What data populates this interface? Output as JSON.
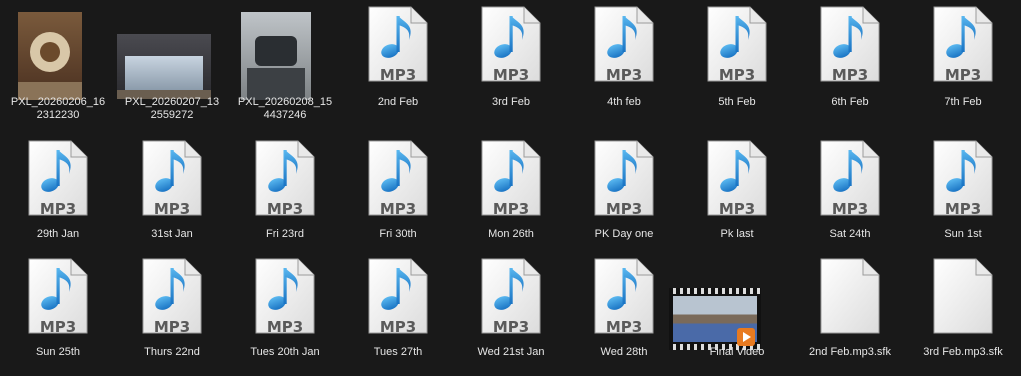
{
  "files": [
    {
      "name": "PXL_20260206_16\n2312230",
      "type": "photo",
      "icon": "photo-thumbnail-icon"
    },
    {
      "name": "PXL_20260207_13\n2559272",
      "type": "photo",
      "icon": "photo-thumbnail-icon"
    },
    {
      "name": "PXL_20260208_15\n4437246",
      "type": "photo",
      "icon": "photo-thumbnail-icon"
    },
    {
      "name": "2nd Feb",
      "type": "mp3",
      "icon": "mp3-file-icon"
    },
    {
      "name": "3rd Feb",
      "type": "mp3",
      "icon": "mp3-file-icon"
    },
    {
      "name": "4th feb",
      "type": "mp3",
      "icon": "mp3-file-icon"
    },
    {
      "name": "5th Feb",
      "type": "mp3",
      "icon": "mp3-file-icon"
    },
    {
      "name": "6th Feb",
      "type": "mp3",
      "icon": "mp3-file-icon"
    },
    {
      "name": "7th Feb",
      "type": "mp3",
      "icon": "mp3-file-icon"
    },
    {
      "name": "29th Jan",
      "type": "mp3",
      "icon": "mp3-file-icon"
    },
    {
      "name": "31st Jan",
      "type": "mp3",
      "icon": "mp3-file-icon"
    },
    {
      "name": "Fri 23rd",
      "type": "mp3",
      "icon": "mp3-file-icon"
    },
    {
      "name": "Fri 30th",
      "type": "mp3",
      "icon": "mp3-file-icon"
    },
    {
      "name": "Mon 26th",
      "type": "mp3",
      "icon": "mp3-file-icon"
    },
    {
      "name": "PK Day one",
      "type": "mp3",
      "icon": "mp3-file-icon"
    },
    {
      "name": "Pk last",
      "type": "mp3",
      "icon": "mp3-file-icon"
    },
    {
      "name": "Sat 24th",
      "type": "mp3",
      "icon": "mp3-file-icon"
    },
    {
      "name": "Sun 1st",
      "type": "mp3",
      "icon": "mp3-file-icon"
    },
    {
      "name": "Sun 25th",
      "type": "mp3",
      "icon": "mp3-file-icon"
    },
    {
      "name": "Thurs 22nd",
      "type": "mp3",
      "icon": "mp3-file-icon"
    },
    {
      "name": "Tues 20th Jan",
      "type": "mp3",
      "icon": "mp3-file-icon"
    },
    {
      "name": "Tues 27th",
      "type": "mp3",
      "icon": "mp3-file-icon"
    },
    {
      "name": "Wed 21st Jan",
      "type": "mp3",
      "icon": "mp3-file-icon"
    },
    {
      "name": "Wed 28th",
      "type": "mp3",
      "icon": "mp3-file-icon"
    },
    {
      "name": "Final Video",
      "type": "video",
      "icon": "video-thumbnail-icon"
    },
    {
      "name": "2nd Feb.mp3.sfk",
      "type": "blank",
      "icon": "blank-file-icon"
    },
    {
      "name": "3rd Feb.mp3.sfk",
      "type": "blank",
      "icon": "blank-file-icon"
    }
  ],
  "mp3_badge_text": "MP3",
  "colors": {
    "background": "#191919",
    "label": "#e6e6e6",
    "note_blue": "#2a8fd6"
  }
}
